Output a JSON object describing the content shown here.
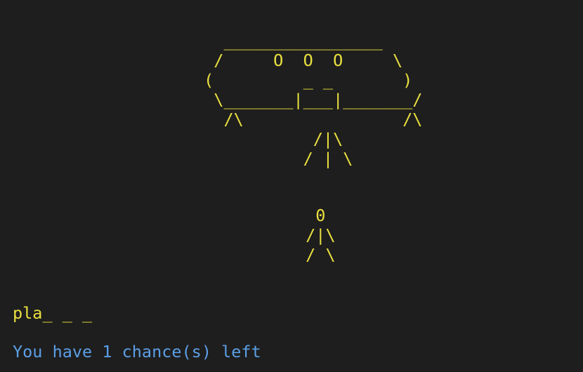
{
  "colors": {
    "background": "#1e1e1e",
    "art": "#e9e040",
    "word": "#e9e040",
    "status": "#5b9fe6"
  },
  "ufo": {
    "art": "   ________________\n  /     O  O  O     \\\n (         _ _       )\n  \\_______|___|_______/\n   /\\                /\\\n            /|\\\n           / | \\"
  },
  "person": {
    "art": "  0\n /|\\\n / \\"
  },
  "game": {
    "word_display": "pla_ _ _",
    "status_text": "You have 1 chance(s) left"
  }
}
